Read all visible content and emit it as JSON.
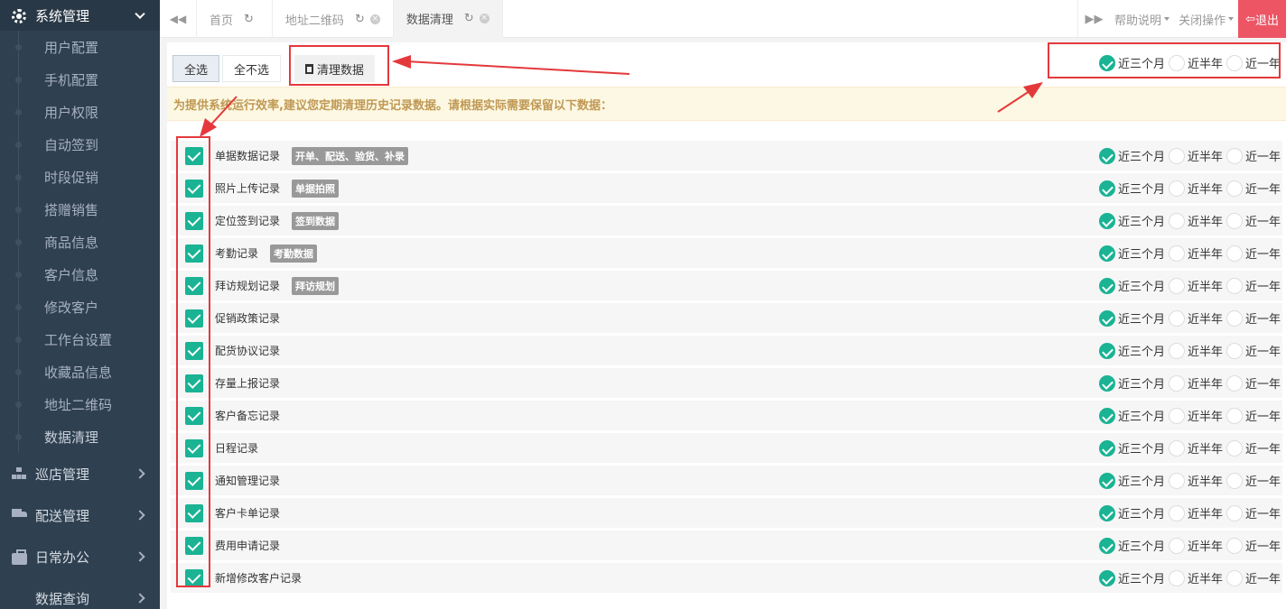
{
  "sidebar": {
    "system_group": "系统管理",
    "items": [
      {
        "label": "用户配置"
      },
      {
        "label": "手机配置"
      },
      {
        "label": "用户权限"
      },
      {
        "label": "自动签到"
      },
      {
        "label": "时段促销"
      },
      {
        "label": "搭赠销售"
      },
      {
        "label": "商品信息"
      },
      {
        "label": "客户信息"
      },
      {
        "label": "修改客户"
      },
      {
        "label": "工作台设置"
      },
      {
        "label": "收藏品信息"
      },
      {
        "label": "地址二维码"
      },
      {
        "label": "数据清理"
      }
    ],
    "groups": [
      {
        "label": "巡店管理"
      },
      {
        "label": "配送管理"
      },
      {
        "label": "日常办公"
      },
      {
        "label": "数据查询"
      }
    ]
  },
  "tabs": [
    {
      "label": "首页"
    },
    {
      "label": "地址二维码"
    },
    {
      "label": "数据清理"
    }
  ],
  "topbar": {
    "help": "帮助说明",
    "close_ops": "关闭操作",
    "logout": "退出"
  },
  "toolbar": {
    "select_all": "全选",
    "select_none": "全不选",
    "clean": "清理数据"
  },
  "periods": [
    "近三个月",
    "近半年",
    "近一年"
  ],
  "notice": "为提供系统运行效率,建议您定期清理历史记录数据。请根据实际需要保留以下数据：",
  "records": [
    {
      "label": "单据数据记录",
      "badge": "开单、配送、验货、补录"
    },
    {
      "label": "照片上传记录",
      "badge": "单据拍照"
    },
    {
      "label": "定位签到记录",
      "badge": "签到数据"
    },
    {
      "label": "考勤记录",
      "badge": "考勤数据"
    },
    {
      "label": "拜访规划记录",
      "badge": "拜访规划"
    },
    {
      "label": "促销政策记录",
      "badge": ""
    },
    {
      "label": "配货协议记录",
      "badge": ""
    },
    {
      "label": "存量上报记录",
      "badge": ""
    },
    {
      "label": "客户备忘记录",
      "badge": ""
    },
    {
      "label": "日程记录",
      "badge": ""
    },
    {
      "label": "通知管理记录",
      "badge": ""
    },
    {
      "label": "客户卡单记录",
      "badge": ""
    },
    {
      "label": "费用申请记录",
      "badge": ""
    },
    {
      "label": "新增修改客户记录",
      "badge": ""
    }
  ],
  "colors": {
    "sidebar_bg": "#2f4050",
    "accent": "#1ab394",
    "logout": "#ed5565",
    "annotation": "#e4393c"
  }
}
